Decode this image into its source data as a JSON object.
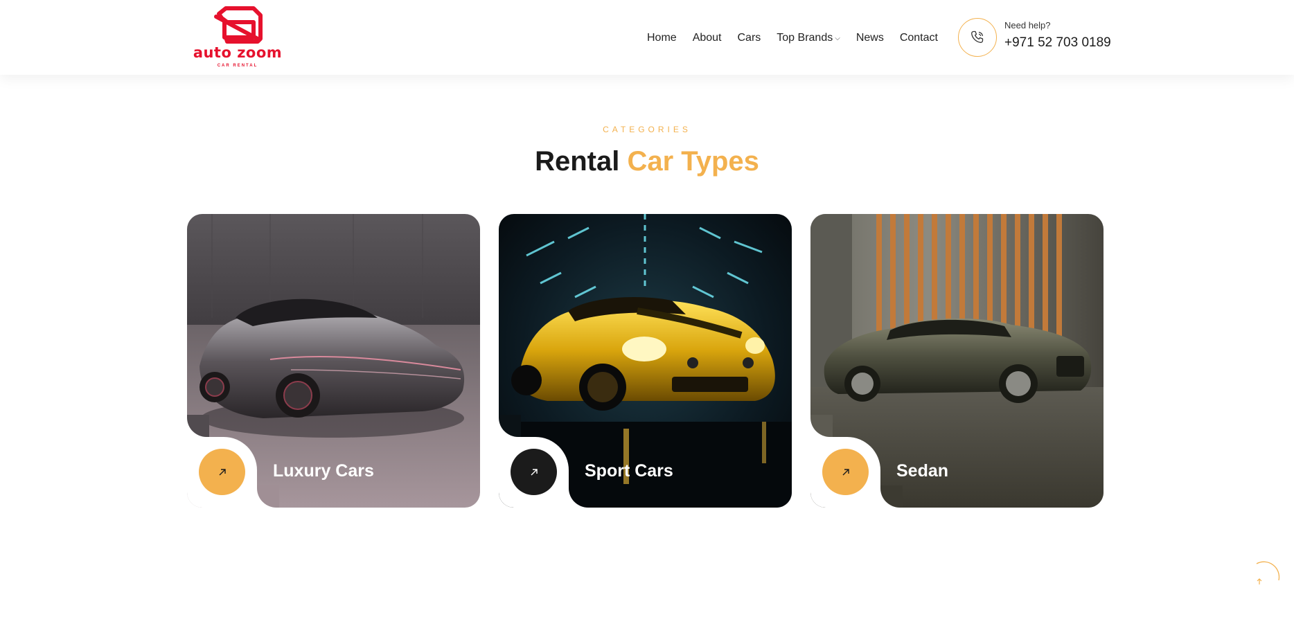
{
  "brand": {
    "name": "auto zoom",
    "tagline": "CAR RENTAL",
    "color": "#e6112d"
  },
  "nav": {
    "items": [
      {
        "label": "Home"
      },
      {
        "label": "About"
      },
      {
        "label": "Cars"
      },
      {
        "label": "Top Brands",
        "has_dropdown": true
      },
      {
        "label": "News"
      },
      {
        "label": "Contact"
      }
    ]
  },
  "contact": {
    "help_label": "Need help?",
    "phone": "+971 52 703 0189",
    "icon": "phone-icon"
  },
  "section": {
    "eyebrow": "CATEGORIES",
    "title_part1": "Rental",
    "title_part2": "Car Types"
  },
  "cards": [
    {
      "label": "Luxury Cars",
      "button_color": "#f3b14e",
      "icon": "arrow-up-right-icon"
    },
    {
      "label": "Sport Cars",
      "button_color": "#1b1b1b",
      "icon": "arrow-up-right-icon"
    },
    {
      "label": "Sedan",
      "button_color": "#f3b14e",
      "icon": "arrow-up-right-icon"
    }
  ],
  "colors": {
    "accent": "#f3b14e",
    "dark": "#1b1b1b"
  },
  "scroll_top": {
    "icon": "arrow-up-icon"
  }
}
